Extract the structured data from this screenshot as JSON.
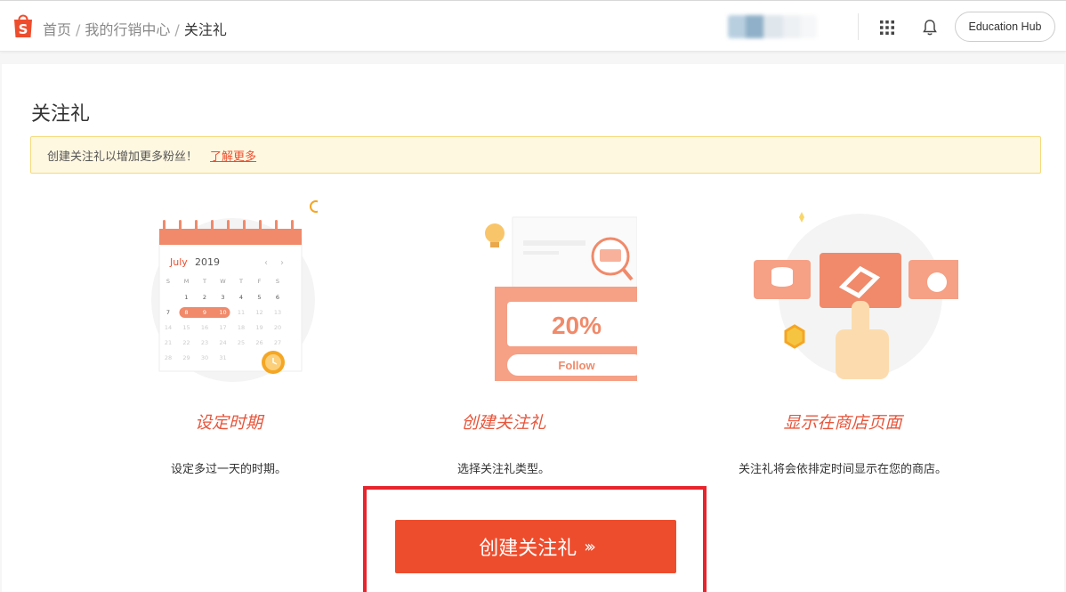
{
  "header": {
    "breadcrumb": [
      "首页",
      "我的行销中心",
      "关注礼"
    ],
    "separator": "/",
    "education_hub_label": "Education Hub",
    "icons": [
      "shopee-logo-icon",
      "apps-grid-icon",
      "bell-icon"
    ]
  },
  "page": {
    "title": "关注礼",
    "notice_text": "创建关注礼以增加更多粉丝！",
    "notice_link": "了解更多"
  },
  "steps": [
    {
      "title": "设定时期",
      "description": "设定多过一天的时期。",
      "illustration": "calendar-icon",
      "calendar": {
        "month": "July",
        "year": "2019",
        "weekdays": [
          "S",
          "M",
          "T",
          "W",
          "T",
          "F",
          "S"
        ],
        "days": [
          [
            "",
            "1",
            "2",
            "3",
            "4",
            "5",
            "6"
          ],
          [
            "7",
            "8",
            "9",
            "10",
            "11",
            "12",
            "13"
          ],
          [
            "14",
            "15",
            "16",
            "17",
            "18",
            "19",
            "20"
          ],
          [
            "21",
            "22",
            "23",
            "24",
            "25",
            "26",
            "27"
          ],
          [
            "28",
            "29",
            "30",
            "31",
            "",
            "",
            ""
          ]
        ]
      }
    },
    {
      "title": "创建关注礼",
      "description": "选择关注礼类型。",
      "illustration": "voucher-icon",
      "voucher": {
        "discount": "20%",
        "button": "Follow"
      }
    },
    {
      "title": "显示在商店页面",
      "description": "关注礼将会依排定时间显示在您的商店。",
      "illustration": "shop-display-icon"
    }
  ],
  "cta": {
    "label": "创建关注礼",
    "arrows": "›››"
  },
  "colors": {
    "brand": "#ee4d2d",
    "highlight": "#e8242c",
    "notice_bg": "#fff8e1"
  }
}
